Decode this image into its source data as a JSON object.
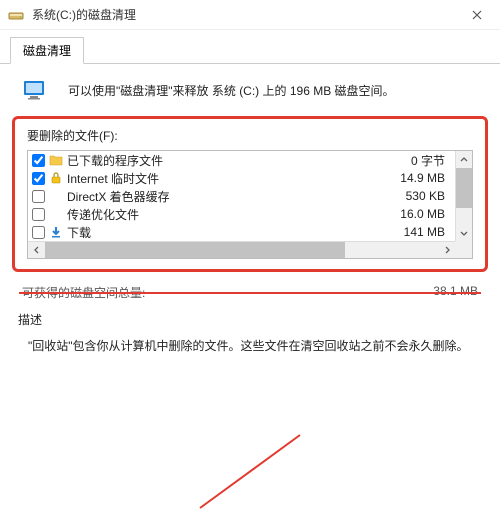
{
  "window": {
    "title": "系统(C:)的磁盘清理"
  },
  "tab": {
    "label": "磁盘清理"
  },
  "summary": {
    "text": "可以使用\"磁盘清理\"来释放 系统 (C:) 上的 196 MB 磁盘空间。"
  },
  "files_section": {
    "label": "要删除的文件(F):",
    "items": [
      {
        "checked": true,
        "icon": "folder",
        "label": "已下载的程序文件",
        "size": "0 字节"
      },
      {
        "checked": true,
        "icon": "lock",
        "label": "Internet 临时文件",
        "size": "14.9 MB"
      },
      {
        "checked": false,
        "icon": "none",
        "label": "DirectX 着色器缓存",
        "size": "530 KB"
      },
      {
        "checked": false,
        "icon": "none",
        "label": "传递优化文件",
        "size": "16.0 MB"
      },
      {
        "checked": false,
        "icon": "download",
        "label": "下载",
        "size": "141 MB"
      }
    ]
  },
  "reclaim": {
    "label": "可获得的磁盘空间总量:",
    "value": "38.1 MB"
  },
  "description": {
    "label": "描述",
    "text": "\"回收站\"包含你从计算机中删除的文件。这些文件在清空回收站之前不会永久删除。"
  }
}
